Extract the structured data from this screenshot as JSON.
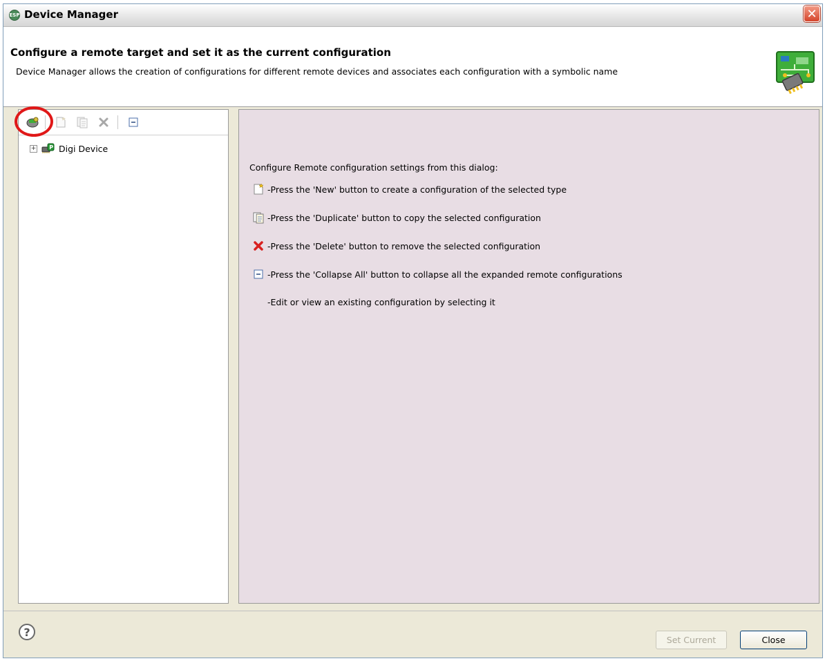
{
  "window": {
    "title": "Device Manager",
    "app_icon_text": "ESP",
    "close_glyph": "✕"
  },
  "header": {
    "title": "Configure a remote target and set it as the current configuration",
    "description": "Device Manager allows the creation of configurations for different remote devices and associates each configuration with a symbolic name",
    "banner_icon": "circuit-board-icon"
  },
  "toolbar": {
    "items": [
      {
        "icon": "new-device-type-icon",
        "enabled": true,
        "highlighted": true
      },
      {
        "icon": "new-icon",
        "enabled": false
      },
      {
        "icon": "duplicate-icon",
        "enabled": false
      },
      {
        "icon": "delete-icon",
        "enabled": false
      },
      {
        "icon": "collapse-all-icon",
        "enabled": true
      }
    ]
  },
  "tree": {
    "items": [
      {
        "label": "Digi Device",
        "icon": "chip-icon",
        "expander": "+"
      }
    ]
  },
  "help_panel": {
    "intro": "Configure Remote configuration settings from this dialog:",
    "items": [
      {
        "icon": "new-icon",
        "text": "-Press the 'New' button to create a configuration of the selected type"
      },
      {
        "icon": "duplicate-icon",
        "text": "-Press the 'Duplicate' button to copy the selected configuration"
      },
      {
        "icon": "delete-icon",
        "text": "-Press the 'Delete' button to remove the selected configuration"
      },
      {
        "icon": "collapse-all-icon",
        "text": "-Press the 'Collapse All' button to collapse all the expanded remote configurations"
      },
      {
        "icon": "",
        "text": "-Edit or view an existing configuration by selecting it"
      }
    ]
  },
  "footer": {
    "help_glyph": "?",
    "set_current_label": "Set Current",
    "close_label": "Close",
    "set_current_enabled": false
  },
  "colors": {
    "panel_background": "#e8dde4",
    "highlight_ring": "#e01818",
    "close_button": "#d4442b"
  }
}
